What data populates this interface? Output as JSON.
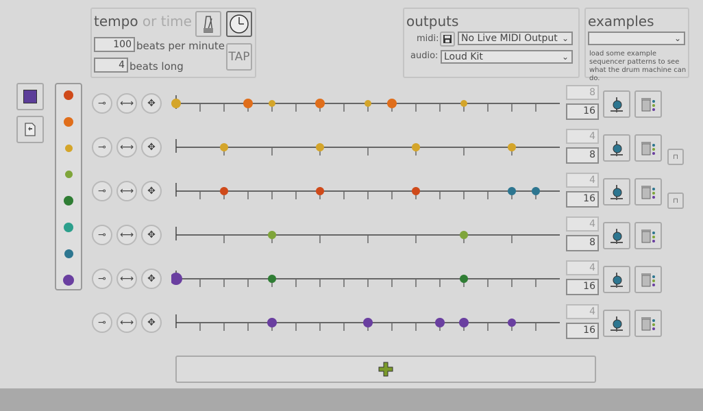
{
  "tempo": {
    "title": "tempo",
    "title_alt": "or time",
    "bpm_value": "100",
    "bpm_label": "beats per minute",
    "beats_value": "4",
    "beats_label": "beats long",
    "tap_label": "TAP"
  },
  "outputs": {
    "title": "outputs",
    "midi_label": "midi:",
    "midi_value": "No Live MIDI Output",
    "audio_label": "audio:",
    "audio_value": "Loud Kit"
  },
  "examples": {
    "title": "examples",
    "select_value": "",
    "help": "load some example sequencer patterns to see what the drum machine can do."
  },
  "palette": [
    "#cf4a1a",
    "#e06e1b",
    "#d4a52a",
    "#7fa53a",
    "#2f7d34",
    "#2c9f8c",
    "#2d7690",
    "#6a3fa0"
  ],
  "icons": {
    "square_color": "#5c3d99",
    "metronome": "metronome-icon",
    "clock": "clock-icon",
    "save": "save-icon",
    "add": "plus-icon"
  },
  "rows": [
    {
      "top": "8",
      "bottom": "16",
      "hits": [
        [
          0,
          "#d4a52a",
          14
        ],
        [
          3,
          "#e06e1b",
          14
        ],
        [
          4,
          "#d4a52a",
          10
        ],
        [
          6,
          "#e06e1b",
          14
        ],
        [
          8,
          "#d4a52a",
          10
        ],
        [
          9,
          "#e06e1b",
          14
        ],
        [
          12,
          "#d4a52a",
          10
        ]
      ],
      "divs": 16,
      "extra": false
    },
    {
      "top": "4",
      "bottom": "8",
      "hits": [
        [
          1,
          "#d4a52a",
          12
        ],
        [
          3,
          "#d4a52a",
          12
        ],
        [
          5,
          "#d4a52a",
          12
        ],
        [
          7,
          "#d4a52a",
          12
        ]
      ],
      "divs": 8,
      "extra": true
    },
    {
      "top": "4",
      "bottom": "16",
      "hits": [
        [
          2,
          "#cf4a1a",
          12
        ],
        [
          6,
          "#cf4a1a",
          12
        ],
        [
          10,
          "#cf4a1a",
          12
        ],
        [
          14,
          "#2d7690",
          12
        ],
        [
          15,
          "#2d7690",
          12
        ]
      ],
      "divs": 16,
      "extra": true
    },
    {
      "top": "4",
      "bottom": "8",
      "hits": [
        [
          2,
          "#7fa53a",
          12
        ],
        [
          6,
          "#7fa53a",
          12
        ]
      ],
      "divs": 8,
      "extra": false
    },
    {
      "top": "4",
      "bottom": "16",
      "hits": [
        [
          0,
          "#6a3fa0",
          18
        ],
        [
          4,
          "#2f7d34",
          12
        ],
        [
          12,
          "#2f7d34",
          12
        ]
      ],
      "divs": 16,
      "extra": false
    },
    {
      "top": "4",
      "bottom": "16",
      "hits": [
        [
          4,
          "#6a3fa0",
          14
        ],
        [
          8,
          "#6a3fa0",
          14
        ],
        [
          11,
          "#6a3fa0",
          14
        ],
        [
          12,
          "#6a3fa0",
          14
        ],
        [
          14,
          "#6a3fa0",
          12
        ]
      ],
      "divs": 16,
      "extra": false
    }
  ]
}
